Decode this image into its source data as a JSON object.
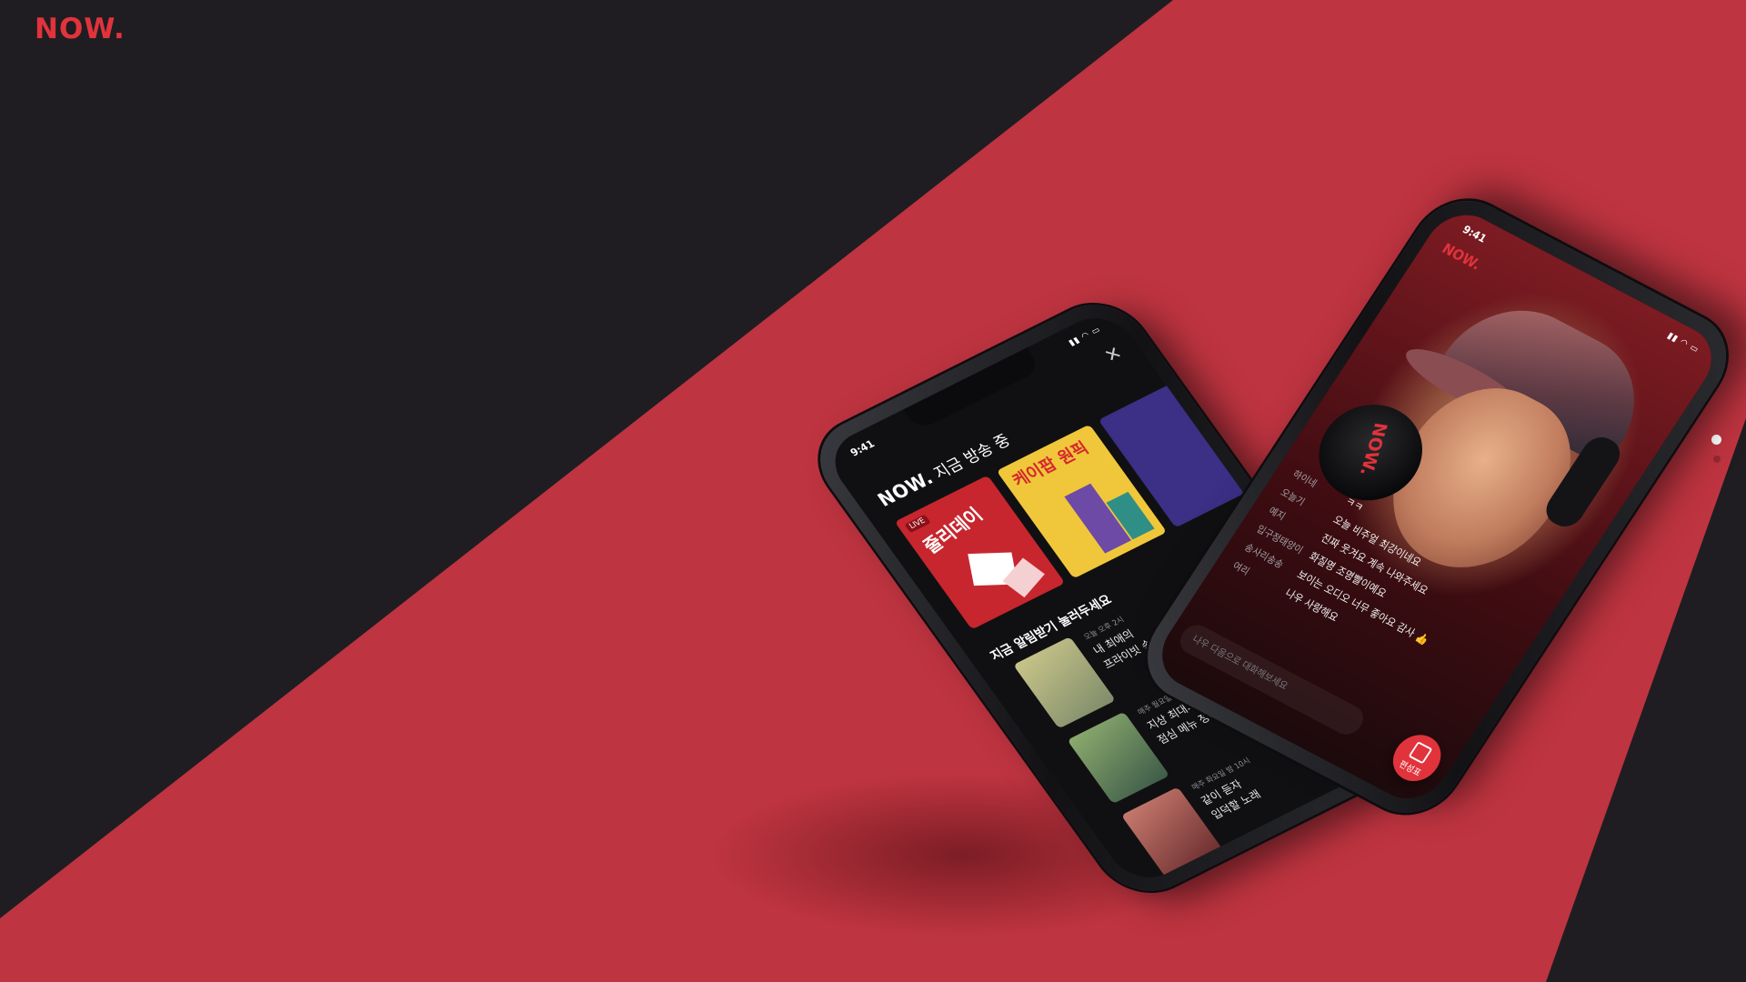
{
  "colors": {
    "background_dark": "#1f1d21",
    "accent_red": "#be3440",
    "brand_red": "#e1333c"
  },
  "header": {
    "logo": "NOW."
  },
  "pagination": {
    "total": 2,
    "active_index": 0
  },
  "phone_list": {
    "status_time": "9:41",
    "close_icon": "close-icon",
    "brand": "NOW.",
    "title": "지금 방송 중",
    "covers": [
      {
        "badge": "LIVE",
        "label": "줄리데이"
      },
      {
        "label": "케이팝 원픽"
      },
      {
        "label": ""
      }
    ],
    "notify_title": "지금 알림받기 눌러두세요",
    "shows": [
      {
        "meta": "오늘 오후 2시",
        "line1": "내 최애의",
        "line2": "프라이빗 송"
      },
      {
        "meta": "매주 월요일 오후 1시",
        "line1": "지상 최대의 고민",
        "line2": "점심 메뉴 정하기"
      },
      {
        "meta": "매주 화요일 밤 10시",
        "line1": "같이 듣자",
        "line2": "입덕할 노래"
      }
    ]
  },
  "phone_live": {
    "status_time": "9:41",
    "logo": "NOW.",
    "mic_logo": "NOW.",
    "chat": [
      {
        "nick": "하이네",
        "msg": "ㅋㅋ"
      },
      {
        "nick": "오늘기",
        "msg": "오늘 비주얼 최강이네요"
      },
      {
        "nick": "예지",
        "msg": "진짜 웃겨요 계속 나와주세요"
      },
      {
        "nick": "입구정태양이",
        "msg": "화질명 조명빨이예요"
      },
      {
        "nick": "송사리송송",
        "msg": "보이는 오디오 너무 좋아요 감사 👍"
      },
      {
        "nick": "여리",
        "msg": "나우 사랑해요"
      }
    ],
    "chat_placeholder": "나우 다음으로 대화해보세요",
    "schedule_button": "편성표"
  }
}
